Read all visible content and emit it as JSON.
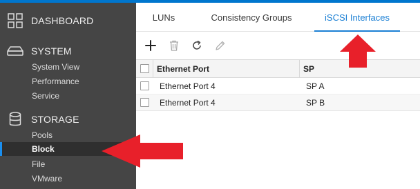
{
  "sidebar": {
    "sections": [
      {
        "label": "DASHBOARD",
        "icon": "dashboard-grid-icon"
      },
      {
        "label": "SYSTEM",
        "icon": "storage-drive-icon"
      },
      {
        "label": "STORAGE",
        "icon": "database-cylinder-icon"
      }
    ],
    "system_items": [
      {
        "label": "System View"
      },
      {
        "label": "Performance"
      },
      {
        "label": "Service"
      }
    ],
    "storage_items": [
      {
        "label": "Pools"
      },
      {
        "label": "Block"
      },
      {
        "label": "File"
      },
      {
        "label": "VMware"
      }
    ],
    "active_item": "Block"
  },
  "tabs": [
    {
      "label": "LUNs"
    },
    {
      "label": "Consistency Groups"
    },
    {
      "label": "iSCSI Interfaces"
    }
  ],
  "active_tab": "iSCSI Interfaces",
  "toolbar": {
    "add": "plus-icon",
    "delete": "trash-icon",
    "refresh": "refresh-icon",
    "edit": "pencil-icon"
  },
  "table": {
    "columns": [
      "Ethernet Port",
      "SP"
    ],
    "rows": [
      [
        "Ethernet Port 4",
        "SP A"
      ],
      [
        "Ethernet Port 4",
        "SP B"
      ]
    ]
  },
  "colors": {
    "accent": "#1a7fd4",
    "sidebar_bg": "#454545",
    "annotation_arrow": "#e8202a"
  }
}
